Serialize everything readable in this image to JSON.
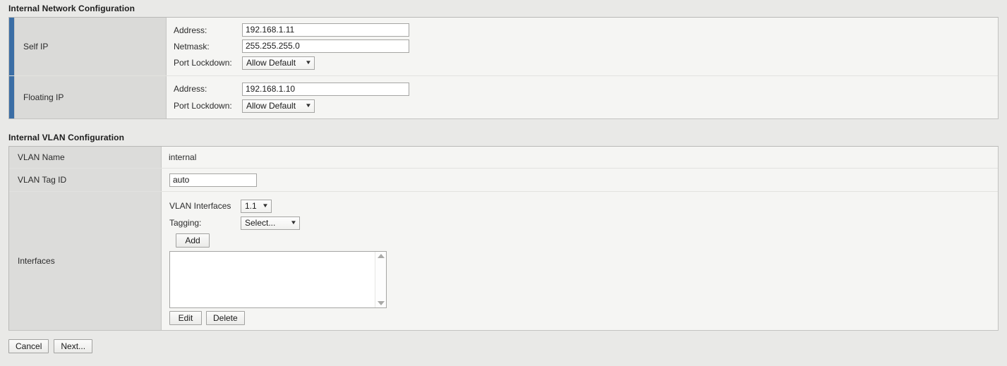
{
  "network_section": {
    "title": "Internal Network Configuration",
    "accent_color": "#3b6ea5",
    "rows": [
      {
        "label": "Self IP",
        "fields": [
          {
            "name": "address",
            "label": "Address:",
            "type": "text",
            "value": "192.168.1.11"
          },
          {
            "name": "netmask",
            "label": "Netmask:",
            "type": "text",
            "value": "255.255.255.0"
          },
          {
            "name": "port_lockdown",
            "label": "Port Lockdown:",
            "type": "select",
            "value": "Allow Default"
          }
        ]
      },
      {
        "label": "Floating IP",
        "fields": [
          {
            "name": "address",
            "label": "Address:",
            "type": "text",
            "value": "192.168.1.10"
          },
          {
            "name": "port_lockdown",
            "label": "Port Lockdown:",
            "type": "select",
            "value": "Allow Default"
          }
        ]
      }
    ]
  },
  "vlan_section": {
    "title": "Internal VLAN Configuration",
    "vlan_name": {
      "label": "VLAN Name",
      "value": "internal"
    },
    "vlan_tag_id": {
      "label": "VLAN Tag ID",
      "value": "auto"
    },
    "interfaces": {
      "label": "Interfaces",
      "vlan_interfaces_label": "VLAN Interfaces",
      "vlan_interfaces_value": "1.1",
      "tagging_label": "Tagging:",
      "tagging_value": "Select...",
      "add_label": "Add",
      "list_items": [],
      "edit_label": "Edit",
      "delete_label": "Delete"
    }
  },
  "footer": {
    "cancel_label": "Cancel",
    "next_label": "Next..."
  },
  "icons": {
    "caret_down": "▼",
    "scroll_up": "scroll-up-arrow-icon",
    "scroll_down": "scroll-down-arrow-icon"
  }
}
